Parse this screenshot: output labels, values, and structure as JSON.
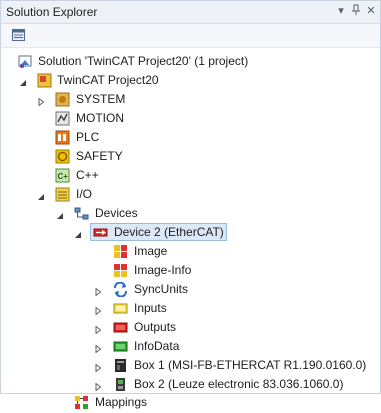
{
  "panel": {
    "title": "Solution Explorer",
    "controls": [
      "▾",
      "ꟷ",
      "✕"
    ]
  },
  "tree": {
    "solution": "Solution 'TwinCAT Project20' (1 project)",
    "project": "TwinCAT Project20",
    "system": "SYSTEM",
    "motion": "MOTION",
    "plc": "PLC",
    "safety": "SAFETY",
    "cpp": "C++",
    "io": "I/O",
    "devices": "Devices",
    "device2": "Device 2 (EtherCAT)",
    "image": "Image",
    "image_info": "Image-Info",
    "syncunits": "SyncUnits",
    "inputs": "Inputs",
    "outputs": "Outputs",
    "infodata": "InfoData",
    "box1": "Box 1 (MSI-FB-ETHERCAT  R1.190.0160.0)",
    "box2": "Box 2 (Leuze electronic  83.036.1060.0)",
    "mappings": "Mappings"
  },
  "colors": {
    "selection_fill": "#dbe8f7",
    "selection_border": "#9cb8dc",
    "titlebar": "#eef1f6"
  }
}
